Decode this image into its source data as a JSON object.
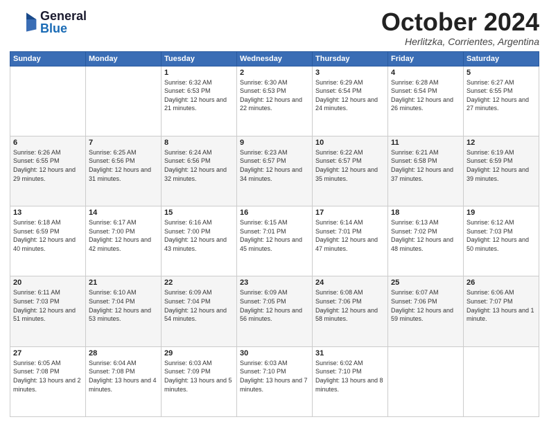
{
  "header": {
    "logo_general": "General",
    "logo_blue": "Blue",
    "month": "October 2024",
    "location": "Herlitzka, Corrientes, Argentina"
  },
  "days_of_week": [
    "Sunday",
    "Monday",
    "Tuesday",
    "Wednesday",
    "Thursday",
    "Friday",
    "Saturday"
  ],
  "weeks": [
    [
      {
        "day": "",
        "sunrise": "",
        "sunset": "",
        "daylight": ""
      },
      {
        "day": "",
        "sunrise": "",
        "sunset": "",
        "daylight": ""
      },
      {
        "day": "1",
        "sunrise": "Sunrise: 6:32 AM",
        "sunset": "Sunset: 6:53 PM",
        "daylight": "Daylight: 12 hours and 21 minutes."
      },
      {
        "day": "2",
        "sunrise": "Sunrise: 6:30 AM",
        "sunset": "Sunset: 6:53 PM",
        "daylight": "Daylight: 12 hours and 22 minutes."
      },
      {
        "day": "3",
        "sunrise": "Sunrise: 6:29 AM",
        "sunset": "Sunset: 6:54 PM",
        "daylight": "Daylight: 12 hours and 24 minutes."
      },
      {
        "day": "4",
        "sunrise": "Sunrise: 6:28 AM",
        "sunset": "Sunset: 6:54 PM",
        "daylight": "Daylight: 12 hours and 26 minutes."
      },
      {
        "day": "5",
        "sunrise": "Sunrise: 6:27 AM",
        "sunset": "Sunset: 6:55 PM",
        "daylight": "Daylight: 12 hours and 27 minutes."
      }
    ],
    [
      {
        "day": "6",
        "sunrise": "Sunrise: 6:26 AM",
        "sunset": "Sunset: 6:55 PM",
        "daylight": "Daylight: 12 hours and 29 minutes."
      },
      {
        "day": "7",
        "sunrise": "Sunrise: 6:25 AM",
        "sunset": "Sunset: 6:56 PM",
        "daylight": "Daylight: 12 hours and 31 minutes."
      },
      {
        "day": "8",
        "sunrise": "Sunrise: 6:24 AM",
        "sunset": "Sunset: 6:56 PM",
        "daylight": "Daylight: 12 hours and 32 minutes."
      },
      {
        "day": "9",
        "sunrise": "Sunrise: 6:23 AM",
        "sunset": "Sunset: 6:57 PM",
        "daylight": "Daylight: 12 hours and 34 minutes."
      },
      {
        "day": "10",
        "sunrise": "Sunrise: 6:22 AM",
        "sunset": "Sunset: 6:57 PM",
        "daylight": "Daylight: 12 hours and 35 minutes."
      },
      {
        "day": "11",
        "sunrise": "Sunrise: 6:21 AM",
        "sunset": "Sunset: 6:58 PM",
        "daylight": "Daylight: 12 hours and 37 minutes."
      },
      {
        "day": "12",
        "sunrise": "Sunrise: 6:19 AM",
        "sunset": "Sunset: 6:59 PM",
        "daylight": "Daylight: 12 hours and 39 minutes."
      }
    ],
    [
      {
        "day": "13",
        "sunrise": "Sunrise: 6:18 AM",
        "sunset": "Sunset: 6:59 PM",
        "daylight": "Daylight: 12 hours and 40 minutes."
      },
      {
        "day": "14",
        "sunrise": "Sunrise: 6:17 AM",
        "sunset": "Sunset: 7:00 PM",
        "daylight": "Daylight: 12 hours and 42 minutes."
      },
      {
        "day": "15",
        "sunrise": "Sunrise: 6:16 AM",
        "sunset": "Sunset: 7:00 PM",
        "daylight": "Daylight: 12 hours and 43 minutes."
      },
      {
        "day": "16",
        "sunrise": "Sunrise: 6:15 AM",
        "sunset": "Sunset: 7:01 PM",
        "daylight": "Daylight: 12 hours and 45 minutes."
      },
      {
        "day": "17",
        "sunrise": "Sunrise: 6:14 AM",
        "sunset": "Sunset: 7:01 PM",
        "daylight": "Daylight: 12 hours and 47 minutes."
      },
      {
        "day": "18",
        "sunrise": "Sunrise: 6:13 AM",
        "sunset": "Sunset: 7:02 PM",
        "daylight": "Daylight: 12 hours and 48 minutes."
      },
      {
        "day": "19",
        "sunrise": "Sunrise: 6:12 AM",
        "sunset": "Sunset: 7:03 PM",
        "daylight": "Daylight: 12 hours and 50 minutes."
      }
    ],
    [
      {
        "day": "20",
        "sunrise": "Sunrise: 6:11 AM",
        "sunset": "Sunset: 7:03 PM",
        "daylight": "Daylight: 12 hours and 51 minutes."
      },
      {
        "day": "21",
        "sunrise": "Sunrise: 6:10 AM",
        "sunset": "Sunset: 7:04 PM",
        "daylight": "Daylight: 12 hours and 53 minutes."
      },
      {
        "day": "22",
        "sunrise": "Sunrise: 6:09 AM",
        "sunset": "Sunset: 7:04 PM",
        "daylight": "Daylight: 12 hours and 54 minutes."
      },
      {
        "day": "23",
        "sunrise": "Sunrise: 6:09 AM",
        "sunset": "Sunset: 7:05 PM",
        "daylight": "Daylight: 12 hours and 56 minutes."
      },
      {
        "day": "24",
        "sunrise": "Sunrise: 6:08 AM",
        "sunset": "Sunset: 7:06 PM",
        "daylight": "Daylight: 12 hours and 58 minutes."
      },
      {
        "day": "25",
        "sunrise": "Sunrise: 6:07 AM",
        "sunset": "Sunset: 7:06 PM",
        "daylight": "Daylight: 12 hours and 59 minutes."
      },
      {
        "day": "26",
        "sunrise": "Sunrise: 6:06 AM",
        "sunset": "Sunset: 7:07 PM",
        "daylight": "Daylight: 13 hours and 1 minute."
      }
    ],
    [
      {
        "day": "27",
        "sunrise": "Sunrise: 6:05 AM",
        "sunset": "Sunset: 7:08 PM",
        "daylight": "Daylight: 13 hours and 2 minutes."
      },
      {
        "day": "28",
        "sunrise": "Sunrise: 6:04 AM",
        "sunset": "Sunset: 7:08 PM",
        "daylight": "Daylight: 13 hours and 4 minutes."
      },
      {
        "day": "29",
        "sunrise": "Sunrise: 6:03 AM",
        "sunset": "Sunset: 7:09 PM",
        "daylight": "Daylight: 13 hours and 5 minutes."
      },
      {
        "day": "30",
        "sunrise": "Sunrise: 6:03 AM",
        "sunset": "Sunset: 7:10 PM",
        "daylight": "Daylight: 13 hours and 7 minutes."
      },
      {
        "day": "31",
        "sunrise": "Sunrise: 6:02 AM",
        "sunset": "Sunset: 7:10 PM",
        "daylight": "Daylight: 13 hours and 8 minutes."
      },
      {
        "day": "",
        "sunrise": "",
        "sunset": "",
        "daylight": ""
      },
      {
        "day": "",
        "sunrise": "",
        "sunset": "",
        "daylight": ""
      }
    ]
  ]
}
